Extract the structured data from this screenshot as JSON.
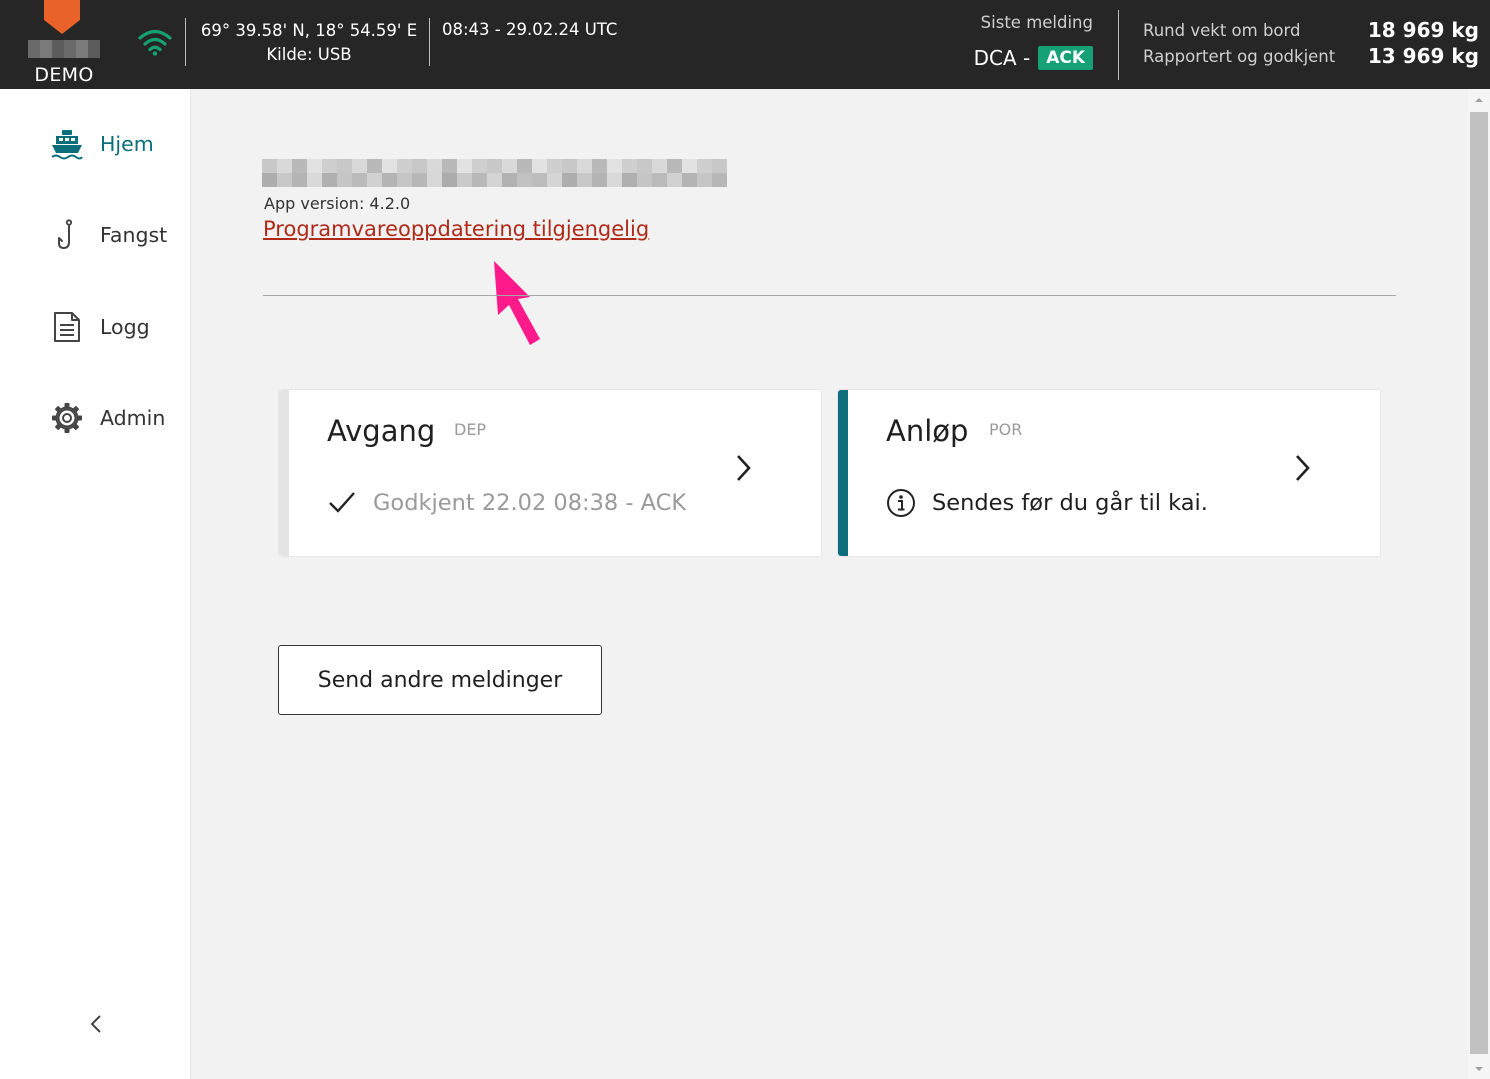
{
  "header": {
    "logo_text": "DEMO",
    "gps_coords": "69° 39.58' N, 18° 54.59' E",
    "gps_source": "Kilde: USB",
    "datetime": "08:43 - 29.02.24 UTC",
    "last_message_label": "Siste melding",
    "last_message_type": "DCA -",
    "last_message_status": "ACK",
    "round_weight_label": "Rund vekt om bord",
    "round_weight_value": "18 969 kg",
    "reported_label": "Rapportert og godkjent",
    "reported_value": "13 969 kg",
    "colors": {
      "brand_orange": "#e8622a",
      "wifi_green": "#15a173",
      "ack_green": "#15a173"
    }
  },
  "sidebar": {
    "items": [
      {
        "label": "Hjem",
        "icon": "ship-icon",
        "active": true
      },
      {
        "label": "Fangst",
        "icon": "fishing-hook-icon",
        "active": false
      },
      {
        "label": "Logg",
        "icon": "document-icon",
        "active": false
      },
      {
        "label": "Admin",
        "icon": "gear-icon",
        "active": false
      }
    ],
    "collapse_icon": "chevron-left-icon",
    "active_color": "#0c6e7c"
  },
  "main": {
    "app_version": "App version: 4.2.0",
    "update_link": "Programvareoppdatering tilgjengelig",
    "cards": [
      {
        "title": "Avgang",
        "code": "DEP",
        "status_icon": "checkmark-icon",
        "status_text": "Godkjent 22.02 08:38 - ACK",
        "accent_color": "#e4e4e4"
      },
      {
        "title": "Anløp",
        "code": "POR",
        "status_icon": "info-icon",
        "status_text": "Sendes før du går til kai.",
        "accent_color": "#0c6e7c"
      }
    ],
    "send_button": "Send andre meldinger",
    "annotation_color": "#ff1a8c"
  }
}
